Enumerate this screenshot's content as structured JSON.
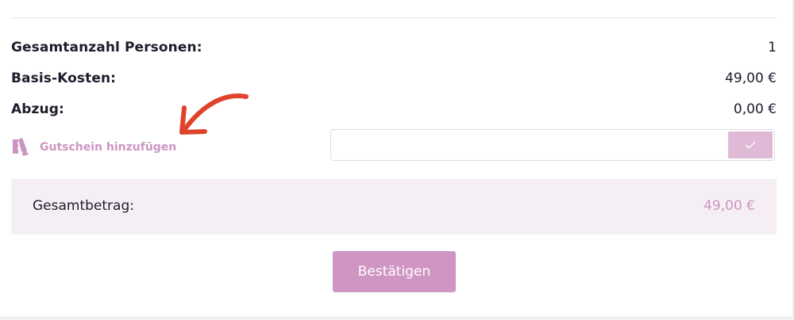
{
  "summary": {
    "persons_label": "Gesamtanzahl Personen:",
    "persons_value": "1",
    "base_label": "Basis-Kosten:",
    "base_value": "49,00 €",
    "discount_label": "Abzug:",
    "discount_value": "0,00 €"
  },
  "voucher": {
    "link_label": "Gutschein hinzufügen",
    "input_value": "",
    "input_placeholder": "",
    "submit_icon": "check-icon",
    "link_icon": "voucher-ticket-icon"
  },
  "total": {
    "label": "Gesamtbetrag:",
    "value": "49,00 €"
  },
  "actions": {
    "confirm_label": "Bestätigen"
  },
  "colors": {
    "accent": "#cf95c3",
    "accent_light": "#dfb9d6",
    "total_bg": "#f5eff5",
    "annotation_arrow": "#e0432b",
    "text": "#1f1c2b"
  }
}
